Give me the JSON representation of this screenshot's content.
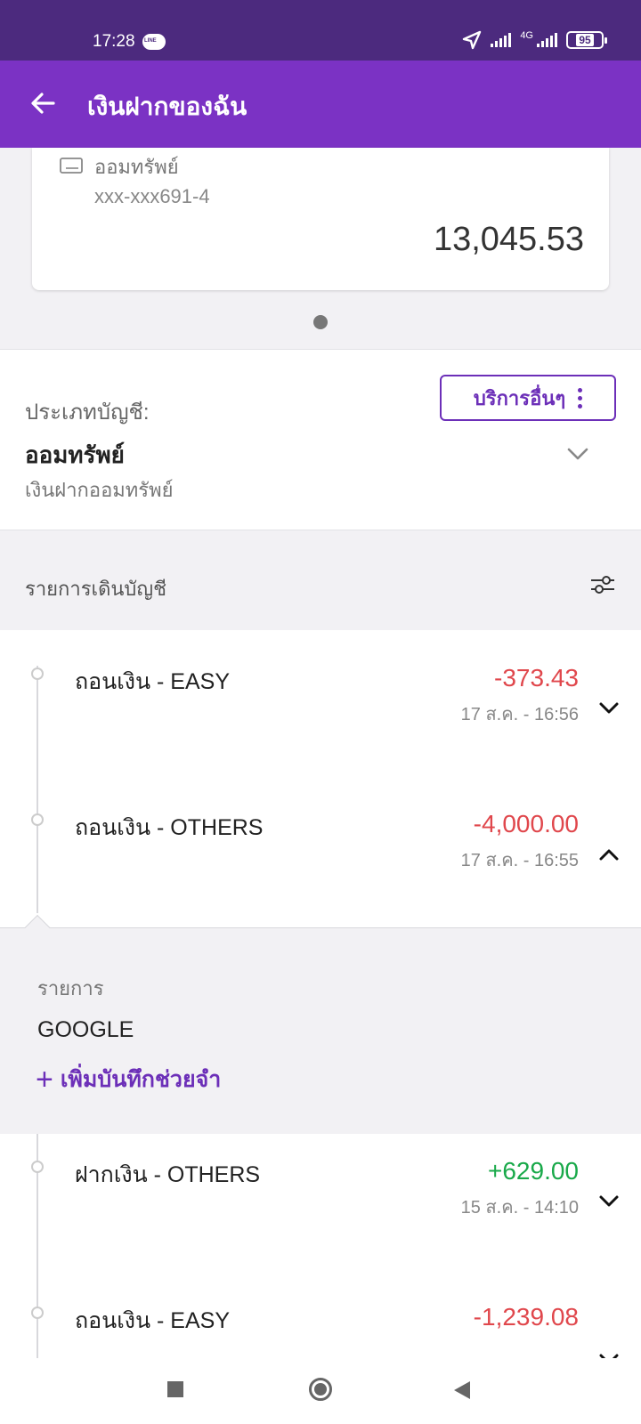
{
  "status_bar": {
    "time": "17:28",
    "app_badge": "LINE",
    "network": "4G",
    "battery": "95"
  },
  "header": {
    "title": "เงินฝากของฉัน"
  },
  "account_card": {
    "type": "ออมทรัพย์",
    "number": "xxx-xxx691-4",
    "balance": "13,045.53"
  },
  "account_info": {
    "type_label": "ประเภทบัญชี:",
    "type_value": "ออมทรัพย์",
    "type_sub": "เงินฝากออมทรัพย์",
    "services_button": "บริการอื่นๆ"
  },
  "transactions": {
    "title": "รายการเดินบัญชี",
    "items": [
      {
        "description": "ถอนเงิน - EASY",
        "amount": "-373.43",
        "datetime": "17 ส.ค. - 16:56",
        "direction": "out",
        "expanded": false
      },
      {
        "description": "ถอนเงิน - OTHERS",
        "amount": "-4,000.00",
        "datetime": "17 ส.ค. - 16:55",
        "direction": "out",
        "expanded": true
      },
      {
        "description": "ฝากเงิน - OTHERS",
        "amount": "+629.00",
        "datetime": "15 ส.ค. - 14:10",
        "direction": "in",
        "expanded": false
      },
      {
        "description": "ถอนเงิน - EASY",
        "amount": "-1,239.08",
        "datetime": "",
        "direction": "out",
        "expanded": false
      }
    ],
    "detail": {
      "label": "รายการ",
      "value": "GOOGLE",
      "add_memo": "เพิ่มบันทึกช่วยจำ"
    }
  },
  "colors": {
    "primary": "#7b32c4",
    "status_bar": "#4c2a7e",
    "negative": "#e0474c",
    "positive": "#19a94a"
  }
}
